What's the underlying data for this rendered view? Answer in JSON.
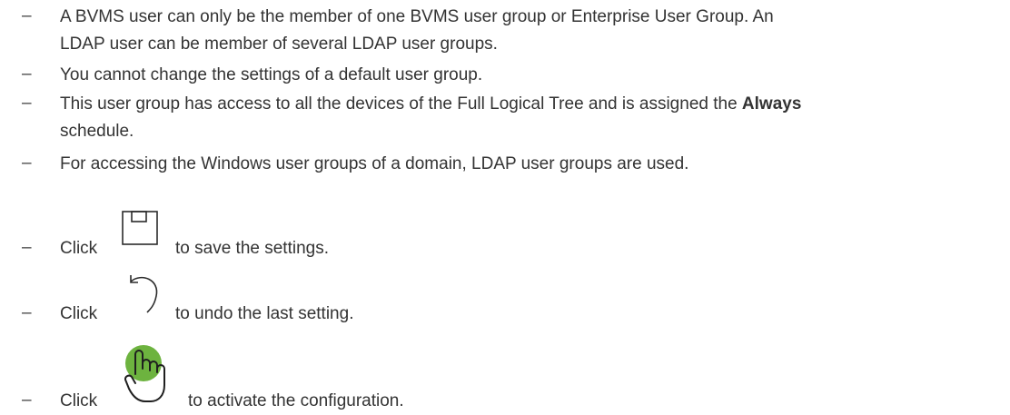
{
  "bullets": [
    {
      "dash": "–",
      "lines": [
        "A BVMS user can only be the member of one BVMS user group or Enterprise User Group. An",
        "LDAP user can be member of several LDAP user groups."
      ]
    },
    {
      "dash": "–",
      "text": "You cannot change the settings of a default user group."
    },
    {
      "dash": "–",
      "line1_before": "This user group has access to all the devices of the Full Logical Tree and is assigned the ",
      "line1_bold": "Always",
      "line2": "schedule."
    },
    {
      "dash": "–",
      "text": "For accessing the Windows user groups of a domain, LDAP user groups are used."
    }
  ],
  "actions": [
    {
      "dash": "–",
      "prefix": "Click",
      "icon": "save-icon",
      "suffix": "to save the settings."
    },
    {
      "dash": "–",
      "prefix": "Click",
      "icon": "undo-icon",
      "suffix": "to undo the last setting."
    },
    {
      "dash": "–",
      "prefix": "Click",
      "icon": "activate-hand-icon",
      "suffix": "to activate the configuration."
    }
  ],
  "colors": {
    "text": "#333333",
    "activate_green": "#6db33f"
  }
}
